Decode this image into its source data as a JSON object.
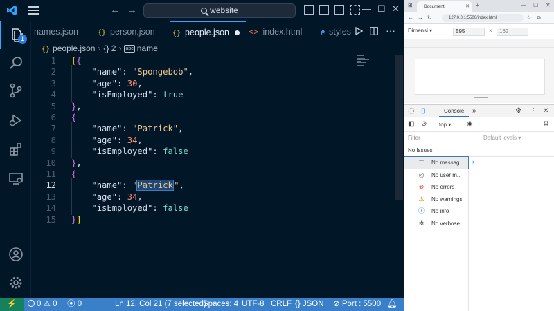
{
  "vscode": {
    "title": {
      "search_label": "website",
      "nav_back": "←",
      "nav_forward": "→",
      "minimize": "—",
      "maximize": "☐",
      "close": "✕"
    },
    "activity_badge": "1",
    "tabs": [
      {
        "label": "names.json",
        "icon": "{}"
      },
      {
        "label": "person.json",
        "icon": "{}"
      },
      {
        "label": "people.json",
        "icon": "{}"
      },
      {
        "label": "index.html",
        "icon": "<>"
      },
      {
        "label": "styles",
        "icon": "#"
      }
    ],
    "breadcrumb": {
      "file": "people.json",
      "braces": "{}",
      "item": "{} 2",
      "symbol_tag": "abc",
      "symbol": "name"
    },
    "code_lines": [
      {
        "n": "1"
      },
      {
        "n": "2"
      },
      {
        "n": "3"
      },
      {
        "n": "4"
      },
      {
        "n": "5"
      },
      {
        "n": "6"
      },
      {
        "n": "7"
      },
      {
        "n": "8"
      },
      {
        "n": "9"
      },
      {
        "n": "10"
      },
      {
        "n": "11"
      },
      {
        "n": "12"
      },
      {
        "n": "13"
      },
      {
        "n": "14"
      },
      {
        "n": "15"
      }
    ],
    "code": {
      "key_name": "\"name\"",
      "key_age": "\"age\"",
      "key_emp": "\"isEmployed\"",
      "v1_name": "\"Spongebob\"",
      "v1_age": "30",
      "v1_emp": "true",
      "v2_name": "\"Patrick\"",
      "v2_age": "34",
      "v2_emp": "false",
      "v3_name_open": "\"",
      "v3_name_sel": "Patrick",
      "v3_name_close": "\"",
      "v3_age": "34",
      "v3_emp": "false"
    },
    "status": {
      "errors": "0",
      "warnings": "0",
      "ports": "0",
      "position": "Ln 12, Col 21 (7 selected)",
      "spaces": "Spaces: 4",
      "encoding": "UTF-8",
      "eol": "CRLF",
      "language_braces": "{}",
      "language": "JSON",
      "live_server": "Port : 5500"
    }
  },
  "browser": {
    "tab_title": "Document",
    "url": "127.0.0.1:5500/index.html",
    "device_label": "Dimensi",
    "width": "595",
    "height": "162",
    "devtools": {
      "tab_console": "Console",
      "context": "top",
      "filter_placeholder": "Filter",
      "levels": "Default levels",
      "issues": "No Issues",
      "sidebar": [
        {
          "label": "No messag...",
          "icon": "list-icon",
          "glyph": "☰",
          "color": "#5f6368"
        },
        {
          "label": "No user m...",
          "icon": "user-icon",
          "glyph": "◎",
          "color": "#5f6368"
        },
        {
          "label": "No errors",
          "icon": "error-icon",
          "glyph": "⊗",
          "color": "#d93025"
        },
        {
          "label": "No warnings",
          "icon": "warning-icon",
          "glyph": "⚠",
          "color": "#e37400"
        },
        {
          "label": "No info",
          "icon": "info-icon",
          "glyph": "ⓘ",
          "color": "#1a73e8"
        },
        {
          "label": "No verbose",
          "icon": "bug-icon",
          "glyph": "✲",
          "color": "#5f6368"
        }
      ]
    }
  }
}
